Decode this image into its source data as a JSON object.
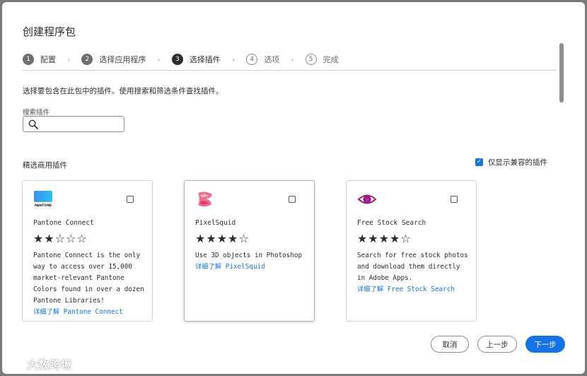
{
  "dialog": {
    "title": "创建程序包",
    "steps": [
      {
        "num": "1",
        "label": "配置",
        "state": "done"
      },
      {
        "num": "2",
        "label": "选择应用程序",
        "state": "done"
      },
      {
        "num": "3",
        "label": "选择插件",
        "state": "current"
      },
      {
        "num": "4",
        "label": "选项",
        "state": "future"
      },
      {
        "num": "5",
        "label": "完成",
        "state": "future"
      }
    ],
    "step_separator": "›",
    "description": "选择要包含在此包中的插件。使用搜索和筛选条件查找插件。",
    "search": {
      "label": "搜索插件",
      "value": "",
      "placeholder": ""
    },
    "section_title": "精选商用插件",
    "compat_filter": {
      "label": "仅显示兼容的插件",
      "checked": true
    },
    "cards": [
      {
        "name": "Pantone Connect",
        "logo_text": "PANTONE",
        "stars": "★★☆☆☆",
        "rating": 2,
        "description": "Pantone Connect is the only way to access over 15,000 market-relevant Pantone Colors found in over a dozen Pantone Libraries!",
        "link": "详细了解 Pantone Connect",
        "checked": false
      },
      {
        "name": "PixelSquid",
        "stars": "★★★★☆",
        "rating": 4,
        "description": "Use 3D objects in Photoshop",
        "link": "详细了解 PixelSquid",
        "checked": false
      },
      {
        "name": "Free Stock Search",
        "stars": "★★★★☆",
        "rating": 4,
        "description": "Search for free stock photos and download them directly in Adobe Apps.",
        "link": "详细了解 Free Stock Search",
        "checked": false
      }
    ],
    "buttons": {
      "cancel": "取消",
      "back": "上一步",
      "next": "下一步"
    }
  },
  "watermark": {
    "text": "大数跨境"
  },
  "colors": {
    "accent": "#1473e6",
    "text": "#2c2c2c",
    "border": "#8e8e8e"
  }
}
